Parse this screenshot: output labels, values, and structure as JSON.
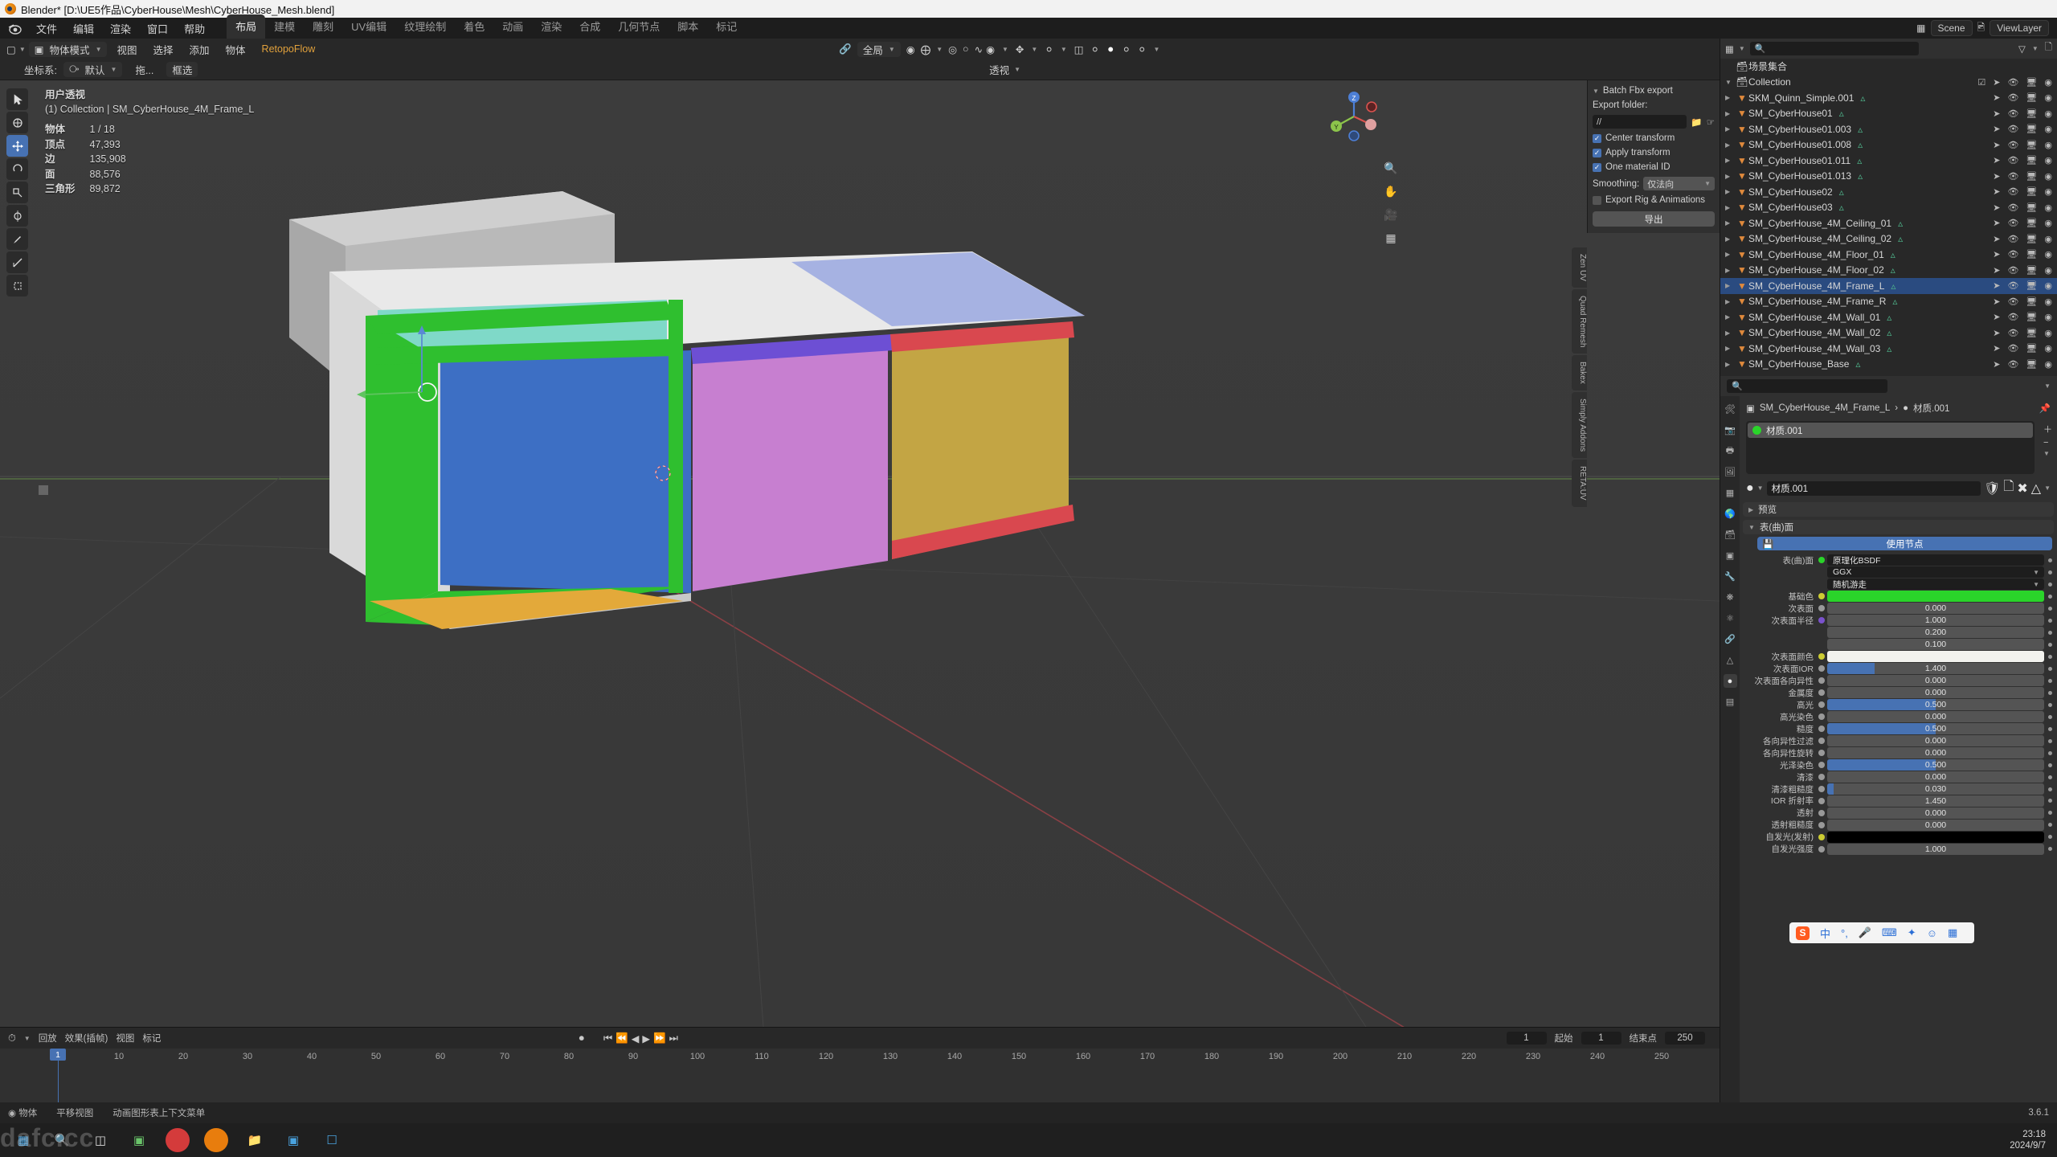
{
  "window": {
    "title": "Blender* [D:\\UE5作品\\CyberHouse\\Mesh\\CyberHouse_Mesh.blend]",
    "logo_icon": "blender-logo-icon"
  },
  "topbar": {
    "menus": [
      "文件",
      "编辑",
      "渲染",
      "窗口",
      "帮助"
    ],
    "workspace_tabs": [
      {
        "label": "布局",
        "active": true
      },
      {
        "label": "建模",
        "active": false
      },
      {
        "label": "雕刻",
        "active": false
      },
      {
        "label": "UV编辑",
        "active": false
      },
      {
        "label": "纹理绘制",
        "active": false
      },
      {
        "label": "着色",
        "active": false
      },
      {
        "label": "动画",
        "active": false
      },
      {
        "label": "渲染",
        "active": false
      },
      {
        "label": "合成",
        "active": false
      },
      {
        "label": "几何节点",
        "active": false
      },
      {
        "label": "脚本",
        "active": false
      },
      {
        "label": "标记",
        "active": false
      }
    ],
    "scene_label": "Scene",
    "viewlayer_label": "ViewLayer"
  },
  "viewport": {
    "header": {
      "mode": "物体模式",
      "menus": [
        "视图",
        "选择",
        "添加",
        "物体"
      ],
      "addon_menu": "RetopoFlow",
      "transform_label": "全局",
      "orientation_label": "坐标系:",
      "orientation_value": "默认",
      "snap_label": "拖...",
      "select_tool": "框选",
      "shading_label": "透视"
    },
    "stats": {
      "view_name": "用户透视",
      "collection_line": "(1) Collection | SM_CyberHouse_4M_Frame_L",
      "rows": [
        {
          "key": "物体",
          "value": "1 / 18"
        },
        {
          "key": "顶点",
          "value": "47,393"
        },
        {
          "key": "边",
          "value": "135,908"
        },
        {
          "key": "面",
          "value": "88,576"
        },
        {
          "key": "三角形",
          "value": "89,872"
        }
      ]
    },
    "tools": [
      {
        "name": "tweak-tool",
        "glyph": "▶",
        "selected": false
      },
      {
        "name": "select-box-tool",
        "glyph": "⧉",
        "selected": false
      },
      {
        "name": "cursor-tool",
        "glyph": "⊕",
        "selected": false
      },
      {
        "name": "move-tool",
        "glyph": "✥",
        "selected": true
      },
      {
        "name": "rotate-tool",
        "glyph": "↻",
        "selected": false
      },
      {
        "name": "scale-tool",
        "glyph": "⬌",
        "selected": false
      },
      {
        "name": "transform-tool",
        "glyph": "✣",
        "selected": false
      },
      {
        "name": "annotate-tool",
        "glyph": "✎",
        "selected": false
      },
      {
        "name": "measure-tool",
        "glyph": "∠",
        "selected": false
      },
      {
        "name": "add-cube-tool",
        "glyph": "▣",
        "selected": false
      }
    ],
    "npanel": {
      "title": "Batch Fbx export",
      "export_folder_label": "Export folder:",
      "export_folder_value": "//",
      "checkboxes": [
        {
          "label": "Center transform",
          "checked": true
        },
        {
          "label": "Apply transform",
          "checked": true
        },
        {
          "label": "One material ID",
          "checked": true
        }
      ],
      "smoothing_label": "Smoothing:",
      "smoothing_value": "仅法向",
      "export_rig_label": "Export Rig & Animations",
      "export_rig_checked": false,
      "export_button": "导出"
    },
    "side_tabs": [
      "Zen UV",
      "Quad Remesh",
      "Bakex",
      "Simply Addons",
      "RETA:UV"
    ],
    "gizmo_axes": [
      {
        "label": "Z",
        "color": "#4d7fd6"
      },
      {
        "label": "Y",
        "color": "#8cc44b"
      },
      {
        "label": "X",
        "color": "#d9534f"
      }
    ]
  },
  "timeline": {
    "editor_label": "回放",
    "keying_label": "效果(插帧)",
    "view_label": "视图",
    "marker_label": "标记",
    "current_frame": "1",
    "start_label": "起始",
    "start_value": "1",
    "end_label": "结束点",
    "end_value": "250",
    "ticks": [
      "10",
      "20",
      "30",
      "40",
      "50",
      "60",
      "70",
      "80",
      "90",
      "100",
      "110",
      "120",
      "130",
      "140",
      "150",
      "160",
      "170",
      "180",
      "190",
      "200",
      "210",
      "220",
      "230",
      "240",
      "250"
    ],
    "playhead_label": "1"
  },
  "outliner": {
    "display_mode_icon": "scene-icon",
    "search_placeholder": "",
    "filter_icon": "filter-icon",
    "new_collection_icon": "new-collection-icon",
    "scene_root": "场景集合",
    "collection": "Collection",
    "items": [
      {
        "name": "SKM_Quinn_Simple.001",
        "selected": false
      },
      {
        "name": "SM_CyberHouse01",
        "selected": false
      },
      {
        "name": "SM_CyberHouse01.003",
        "selected": false
      },
      {
        "name": "SM_CyberHouse01.008",
        "selected": false
      },
      {
        "name": "SM_CyberHouse01.011",
        "selected": false
      },
      {
        "name": "SM_CyberHouse01.013",
        "selected": false
      },
      {
        "name": "SM_CyberHouse02",
        "selected": false
      },
      {
        "name": "SM_CyberHouse03",
        "selected": false
      },
      {
        "name": "SM_CyberHouse_4M_Ceiling_01",
        "selected": false
      },
      {
        "name": "SM_CyberHouse_4M_Ceiling_02",
        "selected": false
      },
      {
        "name": "SM_CyberHouse_4M_Floor_01",
        "selected": false
      },
      {
        "name": "SM_CyberHouse_4M_Floor_02",
        "selected": false
      },
      {
        "name": "SM_CyberHouse_4M_Frame_L",
        "selected": true
      },
      {
        "name": "SM_CyberHouse_4M_Frame_R",
        "selected": false
      },
      {
        "name": "SM_CyberHouse_4M_Wall_01",
        "selected": false
      },
      {
        "name": "SM_CyberHouse_4M_Wall_02",
        "selected": false
      },
      {
        "name": "SM_CyberHouse_4M_Wall_03",
        "selected": false
      },
      {
        "name": "SM_CyberHouse_Base",
        "selected": false
      }
    ]
  },
  "properties": {
    "breadcrumb_object": "SM_CyberHouse_4M_Frame_L",
    "breadcrumb_material": "材质.001",
    "material_slot": "材质.001",
    "material_name": "材质.001",
    "material_color": "#2ad42a",
    "preview_section": "预览",
    "surface_section": "表(曲)面",
    "use_nodes_button": "使用节点",
    "surface_label": "表(曲)面",
    "surface_value": "原理化BSDF",
    "distribution": "GGX",
    "subsurface_method": "随机游走",
    "rows": [
      {
        "label": "基础色",
        "type": "color",
        "color": "#2ad42a",
        "socket": "#cccc33"
      },
      {
        "label": "次表面",
        "type": "slider",
        "value": "0.000",
        "fill": 0,
        "socket": "#999999"
      },
      {
        "label": "次表面半径",
        "type": "slider",
        "value": "1.000",
        "fill": 0,
        "socket": "#7a52cc"
      },
      {
        "label": "",
        "type": "slider",
        "value": "0.200",
        "fill": 0,
        "socket": ""
      },
      {
        "label": "",
        "type": "slider",
        "value": "0.100",
        "fill": 0,
        "socket": ""
      },
      {
        "label": "次表面颜色",
        "type": "color",
        "color": "#f2f2ee",
        "socket": "#cccc33"
      },
      {
        "label": "次表面IOR",
        "type": "slider",
        "value": "1.400",
        "fill": 22,
        "socket": "#999999"
      },
      {
        "label": "次表面各向异性",
        "type": "slider",
        "value": "0.000",
        "fill": 0,
        "socket": "#999999"
      },
      {
        "label": "金属度",
        "type": "slider",
        "value": "0.000",
        "fill": 0,
        "socket": "#999999"
      },
      {
        "label": "高光",
        "type": "slider",
        "value": "0.500",
        "fill": 50,
        "socket": "#999999"
      },
      {
        "label": "高光染色",
        "type": "slider",
        "value": "0.000",
        "fill": 0,
        "socket": "#999999"
      },
      {
        "label": "糙度",
        "type": "slider",
        "value": "0.500",
        "fill": 50,
        "socket": "#999999"
      },
      {
        "label": "各向异性过滤",
        "type": "slider",
        "value": "0.000",
        "fill": 0,
        "socket": "#999999"
      },
      {
        "label": "各向异性旋转",
        "type": "slider",
        "value": "0.000",
        "fill": 0,
        "socket": "#999999"
      },
      {
        "label": "光泽染色",
        "type": "slider",
        "value": "0.500",
        "fill": 50,
        "socket": "#999999"
      },
      {
        "label": "清漆",
        "type": "slider",
        "value": "0.000",
        "fill": 0,
        "socket": "#999999"
      },
      {
        "label": "清漆粗糙度",
        "type": "slider",
        "value": "0.030",
        "fill": 3,
        "socket": "#999999"
      },
      {
        "label": "IOR 折射率",
        "type": "slider",
        "value": "1.450",
        "fill": 0,
        "socket": "#999999"
      },
      {
        "label": "透射",
        "type": "slider",
        "value": "0.000",
        "fill": 0,
        "socket": "#999999"
      },
      {
        "label": "透射粗糙度",
        "type": "slider",
        "value": "0.000",
        "fill": 0,
        "socket": "#999999"
      },
      {
        "label": "自发光(发射)",
        "type": "color",
        "color": "#000000",
        "socket": "#cccc33"
      },
      {
        "label": "自发光强度",
        "type": "slider",
        "value": "1.000",
        "fill": 0,
        "socket": "#999999"
      }
    ]
  },
  "statusbar": {
    "left_hint": "◉ 物体",
    "move_hint": "平移视图",
    "anim_hint": "动画图形表上下文菜单",
    "version": "3.6.1"
  },
  "taskbar": {
    "watermark": "dafc.cc",
    "icons": [
      "windows-start-icon",
      "search-icon",
      "task-view-icon",
      "folder-icon",
      "browser-icon",
      "recorder-icon",
      "blender-icon",
      "explorer-icon",
      "store-icon",
      "app-icon"
    ],
    "clock_time": "23:18",
    "clock_date": "2024/9/7"
  },
  "ime": {
    "logo": "S",
    "mode": "中",
    "items": [
      "°,",
      "mic-icon",
      "keyboard-icon",
      "tools-icon",
      "emoji-icon",
      "grid-icon"
    ]
  }
}
